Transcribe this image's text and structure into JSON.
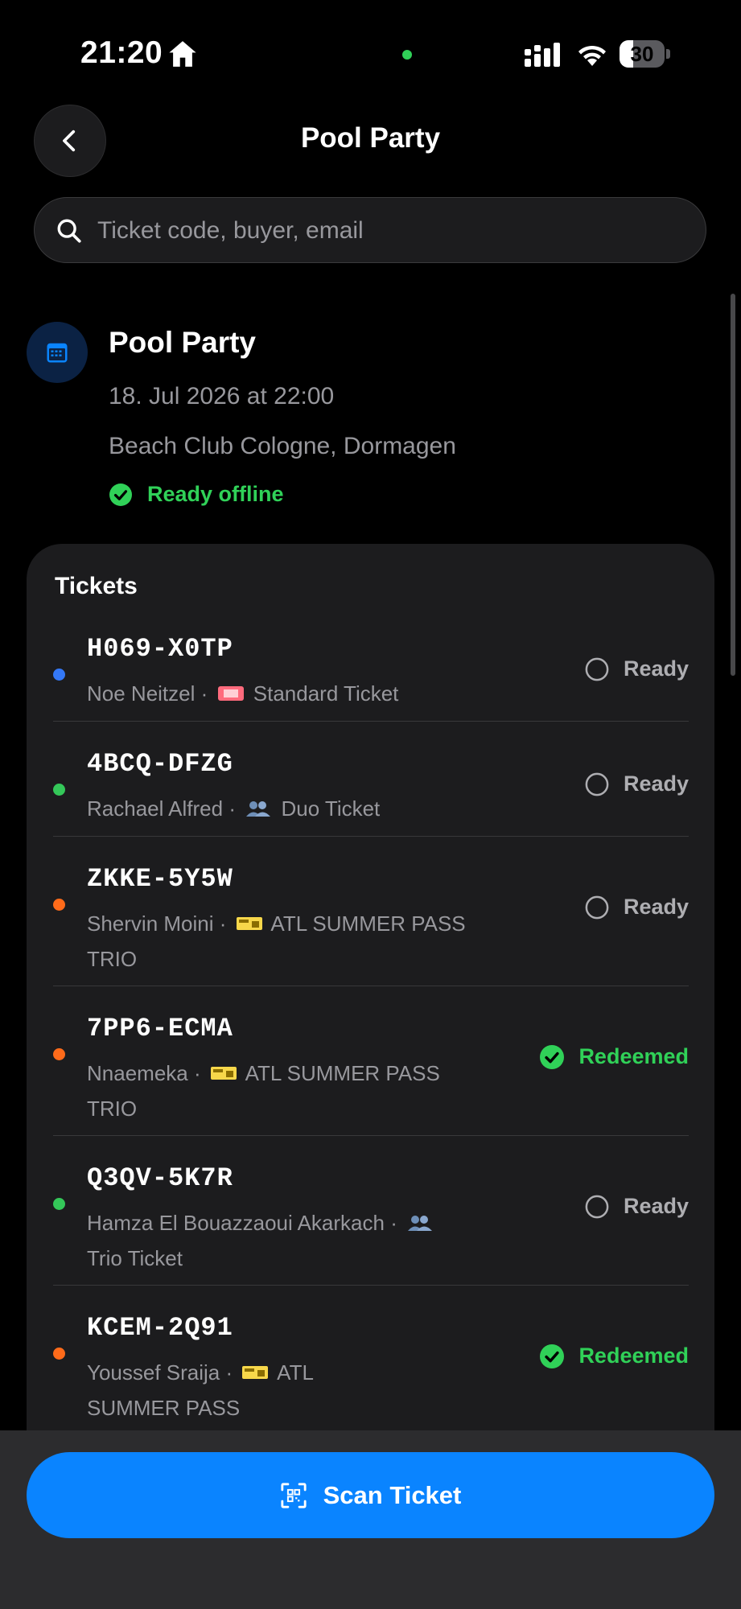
{
  "status_bar": {
    "time": "21:20",
    "battery": "30"
  },
  "header": {
    "title": "Pool Party"
  },
  "search": {
    "placeholder": "Ticket code, buyer, email"
  },
  "event": {
    "title": "Pool Party",
    "date": "18. Jul 2026 at 22:00",
    "venue": "Beach Club Cologne, Dormagen",
    "offline_status": "Ready offline"
  },
  "tickets_section": {
    "title": "Tickets"
  },
  "tickets": [
    {
      "code": "H069-X0TP",
      "buyer": "Noe Neitzel",
      "icon": "admit-one-ticket-icon",
      "type": "Standard Ticket",
      "status": "Ready",
      "dot_color": "#3478f6"
    },
    {
      "code": "4BCQ-DFZG",
      "buyer": "Rachael Alfred",
      "icon": "two-people-icon",
      "type": "Duo Ticket",
      "status": "Ready",
      "dot_color": "#34c759"
    },
    {
      "code": "ZKKE-5Y5W",
      "buyer": "Shervin Moini",
      "icon": "pass-ticket-icon",
      "type": "ATL SUMMER PASS TRIO",
      "status": "Ready",
      "dot_color": "#ff6b1a"
    },
    {
      "code": "7PP6-ECMA",
      "buyer": "Nnaemeka",
      "icon": "pass-ticket-icon",
      "type": "ATL SUMMER PASS TRIO",
      "status": "Redeemed",
      "dot_color": "#ff6b1a"
    },
    {
      "code": "Q3QV-5K7R",
      "buyer": "Hamza El Bouazzaoui Akarkach",
      "icon": "two-people-icon",
      "type": "Trio Ticket",
      "status": "Ready",
      "dot_color": "#34c759"
    },
    {
      "code": "KCEM-2Q91",
      "buyer": "Youssef Sraija",
      "icon": "pass-ticket-icon",
      "type": "ATL SUMMER PASS",
      "status": "Redeemed",
      "dot_color": "#ff6b1a"
    }
  ],
  "actions": {
    "scan_label": "Scan Ticket"
  },
  "colors": {
    "accent": "#0a84ff",
    "success": "#30d158",
    "background": "#000000",
    "card": "#1c1c1e"
  }
}
